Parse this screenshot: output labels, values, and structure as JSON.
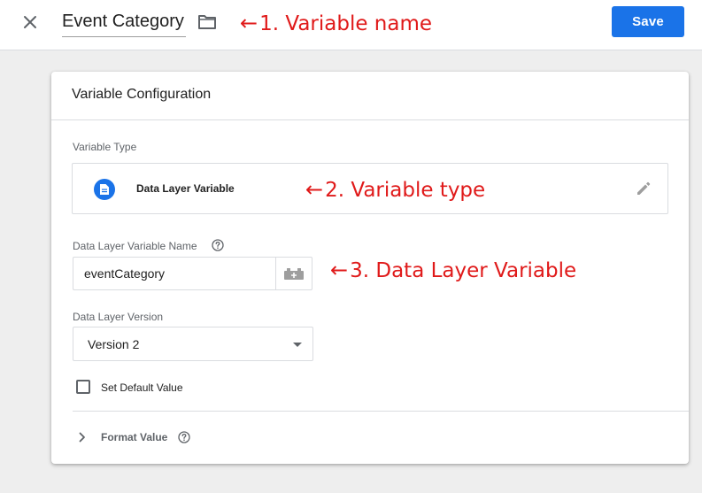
{
  "header": {
    "variable_name": "Event Category",
    "save_label": "Save"
  },
  "annotations": [
    {
      "arrow": "←",
      "text": "1. Variable name"
    },
    {
      "arrow": "←",
      "text": "2. Variable type"
    },
    {
      "arrow": "←",
      "text": "3. Data Layer Variable"
    }
  ],
  "card": {
    "title": "Variable Configuration",
    "variable_type": {
      "label": "Variable Type",
      "name": "Data Layer Variable",
      "icon": "document-icon"
    },
    "dlv_name": {
      "label": "Data Layer Variable Name",
      "value": "eventCategory"
    },
    "dl_version": {
      "label": "Data Layer Version",
      "value": "Version 2"
    },
    "default_value": {
      "label": "Set Default Value",
      "checked": false
    },
    "format_value": {
      "label": "Format Value"
    }
  },
  "colors": {
    "accent": "#1a73e8",
    "annotation": "#e01a1a"
  }
}
